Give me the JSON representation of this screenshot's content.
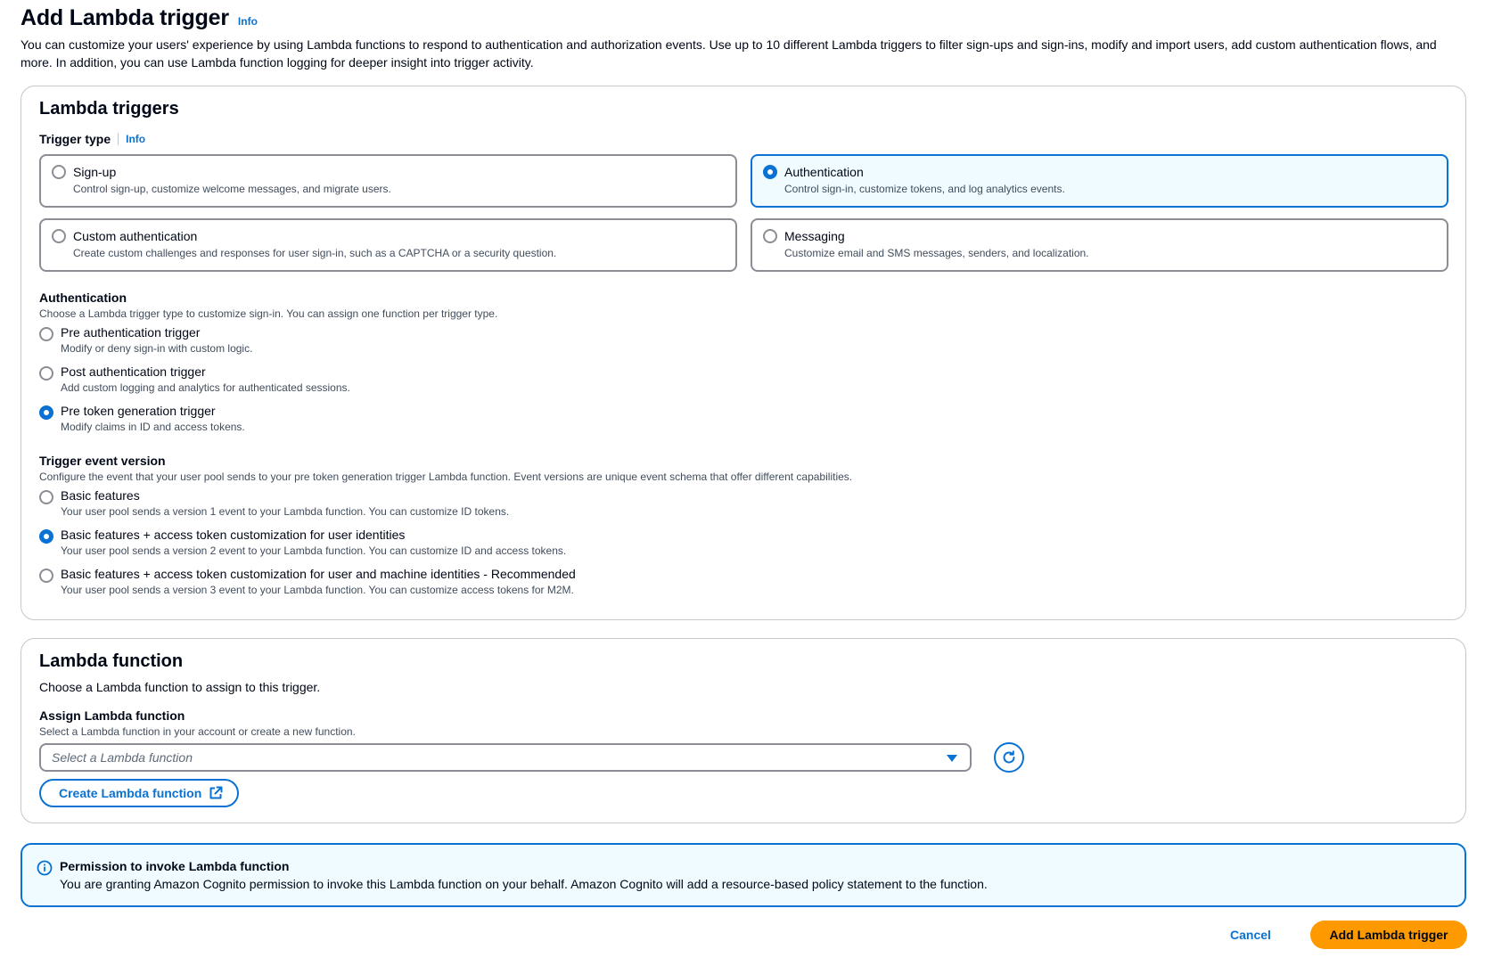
{
  "header": {
    "title": "Add Lambda trigger",
    "info": "Info",
    "description": "You can customize your users' experience by using Lambda functions to respond to authentication and authorization events. Use up to 10 different Lambda triggers to filter sign-ups and sign-ins, modify and import users, add custom authentication flows, and more. In addition, you can use Lambda function logging for deeper insight into trigger activity."
  },
  "triggers": {
    "title": "Lambda triggers",
    "trigger_type_label": "Trigger type",
    "info": "Info",
    "types": [
      {
        "label": "Sign-up",
        "description": "Control sign-up, customize welcome messages, and migrate users.",
        "selected": false
      },
      {
        "label": "Authentication",
        "description": "Control sign-in, customize tokens, and log analytics events.",
        "selected": true
      },
      {
        "label": "Custom authentication",
        "description": "Create custom challenges and responses for user sign-in, such as a CAPTCHA or a security question.",
        "selected": false
      },
      {
        "label": "Messaging",
        "description": "Customize email and SMS messages, senders, and localization.",
        "selected": false
      }
    ],
    "auth_group": {
      "label": "Authentication",
      "description": "Choose a Lambda trigger type to customize sign-in. You can assign one function per trigger type.",
      "options": [
        {
          "label": "Pre authentication trigger",
          "description": "Modify or deny sign-in with custom logic.",
          "selected": false
        },
        {
          "label": "Post authentication trigger",
          "description": "Add custom logging and analytics for authenticated sessions.",
          "selected": false
        },
        {
          "label": "Pre token generation trigger",
          "description": "Modify claims in ID and access tokens.",
          "selected": true
        }
      ]
    },
    "version_group": {
      "label": "Trigger event version",
      "description": "Configure the event that your user pool sends to your pre token generation trigger Lambda function. Event versions are unique event schema that offer different capabilities.",
      "options": [
        {
          "label": "Basic features",
          "description": "Your user pool sends a version 1 event to your Lambda function. You can customize ID tokens.",
          "selected": false
        },
        {
          "label": "Basic features + access token customization for user identities",
          "description": "Your user pool sends a version 2 event to your Lambda function. You can customize ID and access tokens.",
          "selected": true
        },
        {
          "label": "Basic features + access token customization for user and machine identities - Recommended",
          "description": "Your user pool sends a version 3 event to your Lambda function. You can customize access tokens for M2M.",
          "selected": false
        }
      ]
    }
  },
  "function": {
    "title": "Lambda function",
    "description": "Choose a Lambda function to assign to this trigger.",
    "assign_label": "Assign Lambda function",
    "assign_description": "Select a Lambda function in your account or create a new function.",
    "select_placeholder": "Select a Lambda function",
    "create_button": "Create Lambda function"
  },
  "alert": {
    "title": "Permission to invoke Lambda function",
    "body": "You are granting Amazon Cognito permission to invoke this Lambda function on your behalf. Amazon Cognito will add a resource-based policy statement to the function."
  },
  "footer": {
    "cancel": "Cancel",
    "submit": "Add Lambda trigger"
  },
  "colors": {
    "accent": "#0972d3",
    "primary_button": "#ff9900",
    "info_bg": "#f0fbff"
  }
}
